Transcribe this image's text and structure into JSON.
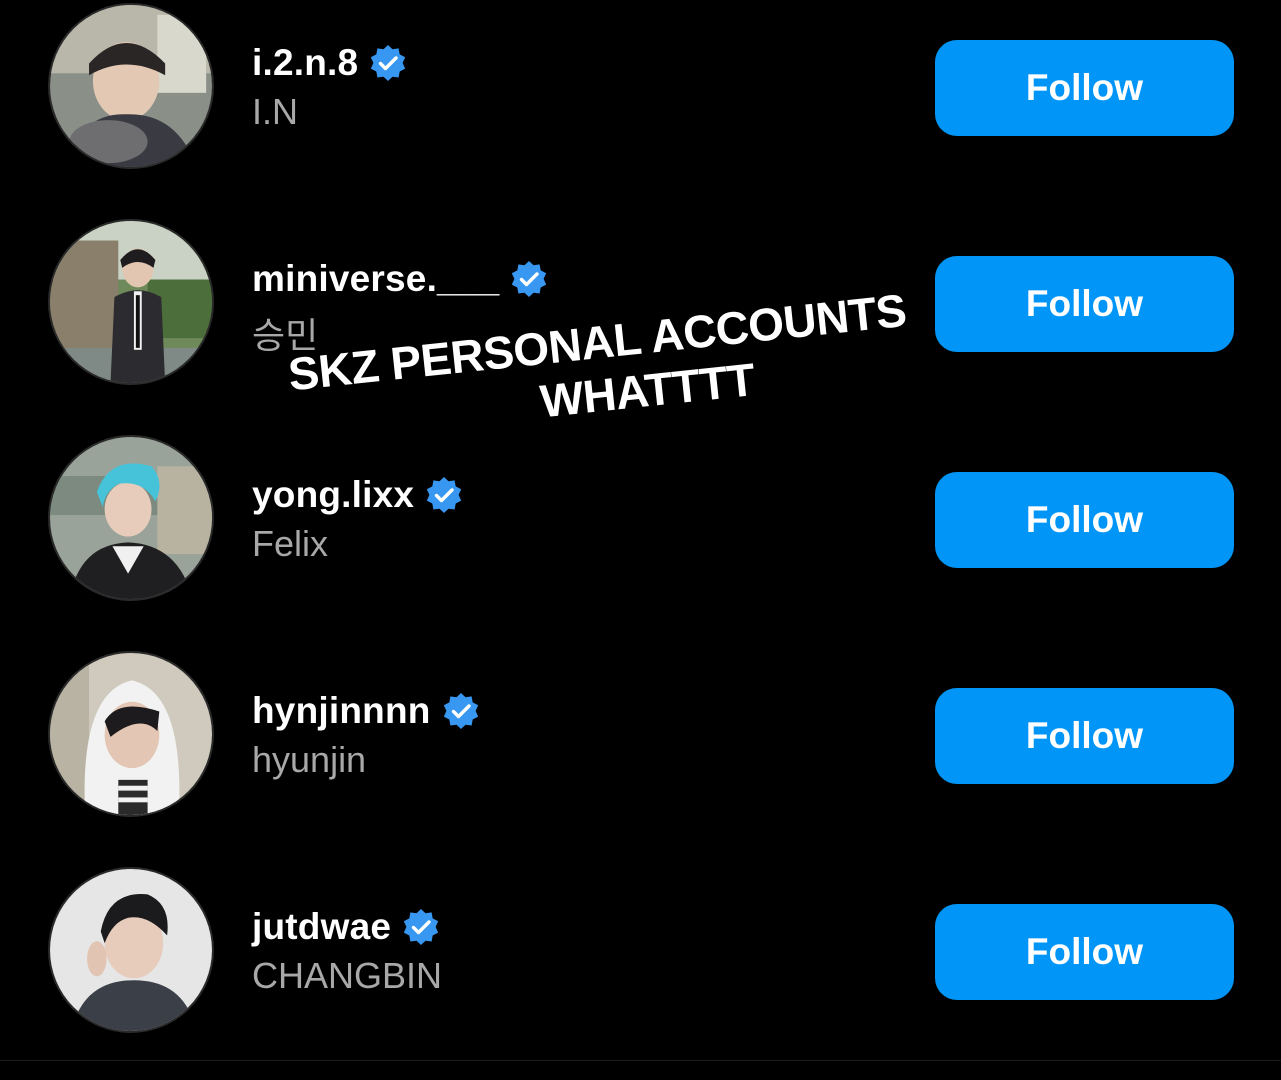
{
  "accounts": [
    {
      "username": "i.2.n.8",
      "full_name": "I.N",
      "verified": true,
      "follow_label": "Follow",
      "avatar_icon": "profile-photo"
    },
    {
      "username": "miniverse.___",
      "full_name": "승민",
      "verified": true,
      "follow_label": "Follow",
      "avatar_icon": "profile-photo"
    },
    {
      "username": "yong.lixx",
      "full_name": "Felix",
      "verified": true,
      "follow_label": "Follow",
      "avatar_icon": "profile-photo"
    },
    {
      "username": "hynjinnnn",
      "full_name": "hyunjin",
      "verified": true,
      "follow_label": "Follow",
      "avatar_icon": "profile-photo"
    },
    {
      "username": "jutdwae",
      "full_name": "CHANGBIN",
      "verified": true,
      "follow_label": "Follow",
      "avatar_icon": "profile-photo"
    }
  ],
  "overlay": {
    "line1": "SKZ PERSONAL ACCOUNTS",
    "line2": "WHATTTT"
  },
  "colors": {
    "background": "#000000",
    "follow_button": "#0095f6",
    "verified_badge": "#3897f0",
    "secondary_text": "#a8a8a8"
  }
}
